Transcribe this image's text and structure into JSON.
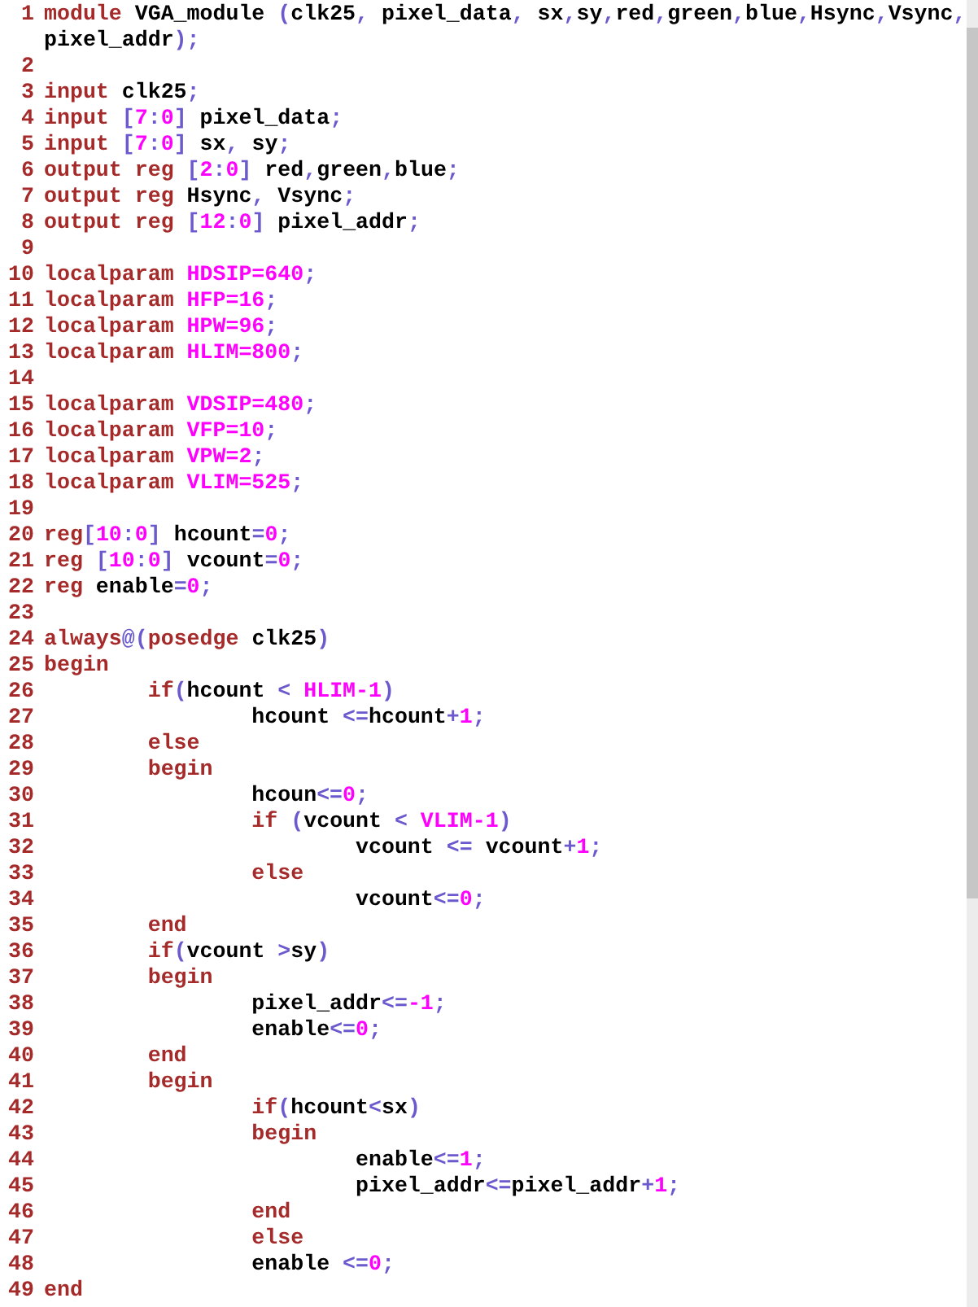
{
  "editor": {
    "lines": [
      {
        "number": "1",
        "tokens": [
          {
            "kind": "kw",
            "text": "module"
          },
          {
            "kind": "id",
            "text": " VGA_module "
          },
          {
            "kind": "op",
            "text": "("
          },
          {
            "kind": "id",
            "text": "clk25"
          },
          {
            "kind": "op",
            "text": ","
          },
          {
            "kind": "id",
            "text": " pixel_data"
          },
          {
            "kind": "op",
            "text": ","
          },
          {
            "kind": "id",
            "text": " sx"
          },
          {
            "kind": "op",
            "text": ","
          },
          {
            "kind": "id",
            "text": "sy"
          },
          {
            "kind": "op",
            "text": ","
          },
          {
            "kind": "id",
            "text": "red"
          },
          {
            "kind": "op",
            "text": ","
          },
          {
            "kind": "id",
            "text": "green"
          },
          {
            "kind": "op",
            "text": ","
          },
          {
            "kind": "id",
            "text": "blue"
          },
          {
            "kind": "op",
            "text": ","
          },
          {
            "kind": "id",
            "text": "Hsync"
          },
          {
            "kind": "op",
            "text": ","
          },
          {
            "kind": "id",
            "text": "Vsync"
          },
          {
            "kind": "op",
            "text": ","
          }
        ],
        "continuation": [
          {
            "kind": "id",
            "text": "pixel_addr"
          },
          {
            "kind": "op",
            "text": ");"
          }
        ]
      },
      {
        "number": "2"
      },
      {
        "number": "3",
        "tokens": [
          {
            "kind": "kw",
            "text": "input"
          },
          {
            "kind": "id",
            "text": " clk25"
          },
          {
            "kind": "op",
            "text": ";"
          }
        ]
      },
      {
        "number": "4",
        "tokens": [
          {
            "kind": "kw",
            "text": "input"
          },
          {
            "kind": "op",
            "text": " ["
          },
          {
            "kind": "num",
            "text": "7"
          },
          {
            "kind": "op",
            "text": ":"
          },
          {
            "kind": "num",
            "text": "0"
          },
          {
            "kind": "op",
            "text": "]"
          },
          {
            "kind": "id",
            "text": " pixel_data"
          },
          {
            "kind": "op",
            "text": ";"
          }
        ]
      },
      {
        "number": "5",
        "tokens": [
          {
            "kind": "kw",
            "text": "input"
          },
          {
            "kind": "op",
            "text": " ["
          },
          {
            "kind": "num",
            "text": "7"
          },
          {
            "kind": "op",
            "text": ":"
          },
          {
            "kind": "num",
            "text": "0"
          },
          {
            "kind": "op",
            "text": "]"
          },
          {
            "kind": "id",
            "text": " sx"
          },
          {
            "kind": "op",
            "text": ","
          },
          {
            "kind": "id",
            "text": " sy"
          },
          {
            "kind": "op",
            "text": ";"
          }
        ]
      },
      {
        "number": "6",
        "tokens": [
          {
            "kind": "kw",
            "text": "output reg"
          },
          {
            "kind": "op",
            "text": " ["
          },
          {
            "kind": "num",
            "text": "2"
          },
          {
            "kind": "op",
            "text": ":"
          },
          {
            "kind": "num",
            "text": "0"
          },
          {
            "kind": "op",
            "text": "]"
          },
          {
            "kind": "id",
            "text": " red"
          },
          {
            "kind": "op",
            "text": ","
          },
          {
            "kind": "id",
            "text": "green"
          },
          {
            "kind": "op",
            "text": ","
          },
          {
            "kind": "id",
            "text": "blue"
          },
          {
            "kind": "op",
            "text": ";"
          }
        ]
      },
      {
        "number": "7",
        "tokens": [
          {
            "kind": "kw",
            "text": "output reg"
          },
          {
            "kind": "id",
            "text": " Hsync"
          },
          {
            "kind": "op",
            "text": ","
          },
          {
            "kind": "id",
            "text": " Vsync"
          },
          {
            "kind": "op",
            "text": ";"
          }
        ]
      },
      {
        "number": "8",
        "tokens": [
          {
            "kind": "kw",
            "text": "output reg"
          },
          {
            "kind": "op",
            "text": " ["
          },
          {
            "kind": "num",
            "text": "12"
          },
          {
            "kind": "op",
            "text": ":"
          },
          {
            "kind": "num",
            "text": "0"
          },
          {
            "kind": "op",
            "text": "]"
          },
          {
            "kind": "id",
            "text": " pixel_addr"
          },
          {
            "kind": "op",
            "text": ";"
          }
        ]
      },
      {
        "number": "9"
      },
      {
        "number": "10",
        "tokens": [
          {
            "kind": "kw",
            "text": "localparam"
          },
          {
            "kind": "num",
            "text": " HDSIP=640"
          },
          {
            "kind": "op",
            "text": ";"
          }
        ]
      },
      {
        "number": "11",
        "tokens": [
          {
            "kind": "kw",
            "text": "localparam"
          },
          {
            "kind": "num",
            "text": " HFP=16"
          },
          {
            "kind": "op",
            "text": ";"
          }
        ]
      },
      {
        "number": "12",
        "tokens": [
          {
            "kind": "kw",
            "text": "localparam"
          },
          {
            "kind": "num",
            "text": " HPW=96"
          },
          {
            "kind": "op",
            "text": ";"
          }
        ]
      },
      {
        "number": "13",
        "tokens": [
          {
            "kind": "kw",
            "text": "localparam"
          },
          {
            "kind": "num",
            "text": " HLIM=800"
          },
          {
            "kind": "op",
            "text": ";"
          }
        ]
      },
      {
        "number": "14"
      },
      {
        "number": "15",
        "tokens": [
          {
            "kind": "kw",
            "text": "localparam"
          },
          {
            "kind": "num",
            "text": " VDSIP=480"
          },
          {
            "kind": "op",
            "text": ";"
          }
        ]
      },
      {
        "number": "16",
        "tokens": [
          {
            "kind": "kw",
            "text": "localparam"
          },
          {
            "kind": "num",
            "text": " VFP=10"
          },
          {
            "kind": "op",
            "text": ";"
          }
        ]
      },
      {
        "number": "17",
        "tokens": [
          {
            "kind": "kw",
            "text": "localparam"
          },
          {
            "kind": "num",
            "text": " VPW=2"
          },
          {
            "kind": "op",
            "text": ";"
          }
        ]
      },
      {
        "number": "18",
        "tokens": [
          {
            "kind": "kw",
            "text": "localparam"
          },
          {
            "kind": "num",
            "text": " VLIM=525"
          },
          {
            "kind": "op",
            "text": ";"
          }
        ]
      },
      {
        "number": "19"
      },
      {
        "number": "20",
        "tokens": [
          {
            "kind": "kw",
            "text": "reg"
          },
          {
            "kind": "op",
            "text": "["
          },
          {
            "kind": "num",
            "text": "10"
          },
          {
            "kind": "op",
            "text": ":"
          },
          {
            "kind": "num",
            "text": "0"
          },
          {
            "kind": "op",
            "text": "]"
          },
          {
            "kind": "id",
            "text": " hcount"
          },
          {
            "kind": "op",
            "text": "="
          },
          {
            "kind": "num",
            "text": "0"
          },
          {
            "kind": "op",
            "text": ";"
          }
        ]
      },
      {
        "number": "21",
        "tokens": [
          {
            "kind": "kw",
            "text": "reg"
          },
          {
            "kind": "op",
            "text": " ["
          },
          {
            "kind": "num",
            "text": "10"
          },
          {
            "kind": "op",
            "text": ":"
          },
          {
            "kind": "num",
            "text": "0"
          },
          {
            "kind": "op",
            "text": "]"
          },
          {
            "kind": "id",
            "text": " vcount"
          },
          {
            "kind": "op",
            "text": "="
          },
          {
            "kind": "num",
            "text": "0"
          },
          {
            "kind": "op",
            "text": ";"
          }
        ]
      },
      {
        "number": "22",
        "tokens": [
          {
            "kind": "kw",
            "text": "reg"
          },
          {
            "kind": "id",
            "text": " enable"
          },
          {
            "kind": "op",
            "text": "="
          },
          {
            "kind": "num",
            "text": "0"
          },
          {
            "kind": "op",
            "text": ";"
          }
        ]
      },
      {
        "number": "23"
      },
      {
        "number": "24",
        "tokens": [
          {
            "kind": "kw",
            "text": "always"
          },
          {
            "kind": "op",
            "text": "@("
          },
          {
            "kind": "kw",
            "text": "posedge"
          },
          {
            "kind": "id",
            "text": " clk25"
          },
          {
            "kind": "op",
            "text": ")"
          }
        ]
      },
      {
        "number": "25",
        "tokens": [
          {
            "kind": "kw",
            "text": "begin"
          }
        ]
      },
      {
        "number": "26",
        "tokens": [
          {
            "kind": "kw",
            "text": "\tif"
          },
          {
            "kind": "op",
            "text": "("
          },
          {
            "kind": "id",
            "text": "hcount "
          },
          {
            "kind": "op",
            "text": "<"
          },
          {
            "kind": "num",
            "text": " HLIM-1"
          },
          {
            "kind": "op",
            "text": ")"
          }
        ]
      },
      {
        "number": "27",
        "tokens": [
          {
            "kind": "id",
            "text": "\t\thcount "
          },
          {
            "kind": "op",
            "text": "<="
          },
          {
            "kind": "id",
            "text": "hcount"
          },
          {
            "kind": "op",
            "text": "+"
          },
          {
            "kind": "num",
            "text": "1"
          },
          {
            "kind": "op",
            "text": ";"
          }
        ]
      },
      {
        "number": "28",
        "tokens": [
          {
            "kind": "kw",
            "text": "\telse"
          }
        ]
      },
      {
        "number": "29",
        "tokens": [
          {
            "kind": "kw",
            "text": "\tbegin"
          }
        ]
      },
      {
        "number": "30",
        "tokens": [
          {
            "kind": "id",
            "text": "\t\thcoun"
          },
          {
            "kind": "op",
            "text": "<="
          },
          {
            "kind": "num",
            "text": "0"
          },
          {
            "kind": "op",
            "text": ";"
          }
        ]
      },
      {
        "number": "31",
        "tokens": [
          {
            "kind": "kw",
            "text": "\t\tif"
          },
          {
            "kind": "op",
            "text": " ("
          },
          {
            "kind": "id",
            "text": "vcount "
          },
          {
            "kind": "op",
            "text": "<"
          },
          {
            "kind": "num",
            "text": " VLIM-1"
          },
          {
            "kind": "op",
            "text": ")"
          }
        ]
      },
      {
        "number": "32",
        "tokens": [
          {
            "kind": "id",
            "text": "\t\t\tvcount "
          },
          {
            "kind": "op",
            "text": "<="
          },
          {
            "kind": "id",
            "text": " vcount"
          },
          {
            "kind": "op",
            "text": "+"
          },
          {
            "kind": "num",
            "text": "1"
          },
          {
            "kind": "op",
            "text": ";"
          }
        ]
      },
      {
        "number": "33",
        "tokens": [
          {
            "kind": "kw",
            "text": "\t\telse"
          }
        ]
      },
      {
        "number": "34",
        "tokens": [
          {
            "kind": "id",
            "text": "\t\t\tvcount"
          },
          {
            "kind": "op",
            "text": "<="
          },
          {
            "kind": "num",
            "text": "0"
          },
          {
            "kind": "op",
            "text": ";"
          }
        ]
      },
      {
        "number": "35",
        "tokens": [
          {
            "kind": "kw",
            "text": "\tend"
          }
        ]
      },
      {
        "number": "36",
        "tokens": [
          {
            "kind": "kw",
            "text": "\tif"
          },
          {
            "kind": "op",
            "text": "("
          },
          {
            "kind": "id",
            "text": "vcount "
          },
          {
            "kind": "op",
            "text": ">"
          },
          {
            "kind": "id",
            "text": "sy"
          },
          {
            "kind": "op",
            "text": ")"
          }
        ]
      },
      {
        "number": "37",
        "tokens": [
          {
            "kind": "kw",
            "text": "\tbegin"
          }
        ]
      },
      {
        "number": "38",
        "tokens": [
          {
            "kind": "id",
            "text": "\t\tpixel_addr"
          },
          {
            "kind": "op",
            "text": "<="
          },
          {
            "kind": "num",
            "text": "-1"
          },
          {
            "kind": "op",
            "text": ";"
          }
        ]
      },
      {
        "number": "39",
        "tokens": [
          {
            "kind": "id",
            "text": "\t\tenable"
          },
          {
            "kind": "op",
            "text": "<="
          },
          {
            "kind": "num",
            "text": "0"
          },
          {
            "kind": "op",
            "text": ";"
          }
        ]
      },
      {
        "number": "40",
        "tokens": [
          {
            "kind": "kw",
            "text": "\tend"
          }
        ]
      },
      {
        "number": "41",
        "tokens": [
          {
            "kind": "kw",
            "text": "\tbegin"
          }
        ]
      },
      {
        "number": "42",
        "tokens": [
          {
            "kind": "kw",
            "text": "\t\tif"
          },
          {
            "kind": "op",
            "text": "("
          },
          {
            "kind": "id",
            "text": "hcount"
          },
          {
            "kind": "op",
            "text": "<"
          },
          {
            "kind": "id",
            "text": "sx"
          },
          {
            "kind": "op",
            "text": ")"
          }
        ]
      },
      {
        "number": "43",
        "tokens": [
          {
            "kind": "kw",
            "text": "\t\tbegin"
          }
        ]
      },
      {
        "number": "44",
        "tokens": [
          {
            "kind": "id",
            "text": "\t\t\tenable"
          },
          {
            "kind": "op",
            "text": "<="
          },
          {
            "kind": "num",
            "text": "1"
          },
          {
            "kind": "op",
            "text": ";"
          }
        ]
      },
      {
        "number": "45",
        "tokens": [
          {
            "kind": "id",
            "text": "\t\t\tpixel_addr"
          },
          {
            "kind": "op",
            "text": "<="
          },
          {
            "kind": "id",
            "text": "pixel_addr"
          },
          {
            "kind": "op",
            "text": "+"
          },
          {
            "kind": "num",
            "text": "1"
          },
          {
            "kind": "op",
            "text": ";"
          }
        ]
      },
      {
        "number": "46",
        "tokens": [
          {
            "kind": "kw",
            "text": "\t\tend"
          }
        ]
      },
      {
        "number": "47",
        "tokens": [
          {
            "kind": "kw",
            "text": "\t\telse"
          }
        ]
      },
      {
        "number": "48",
        "tokens": [
          {
            "kind": "id",
            "text": "\t\tenable "
          },
          {
            "kind": "op",
            "text": "<="
          },
          {
            "kind": "num",
            "text": "0"
          },
          {
            "kind": "op",
            "text": ";"
          }
        ]
      },
      {
        "number": "49",
        "tokens": [
          {
            "kind": "kw",
            "text": "end"
          }
        ]
      }
    ]
  }
}
